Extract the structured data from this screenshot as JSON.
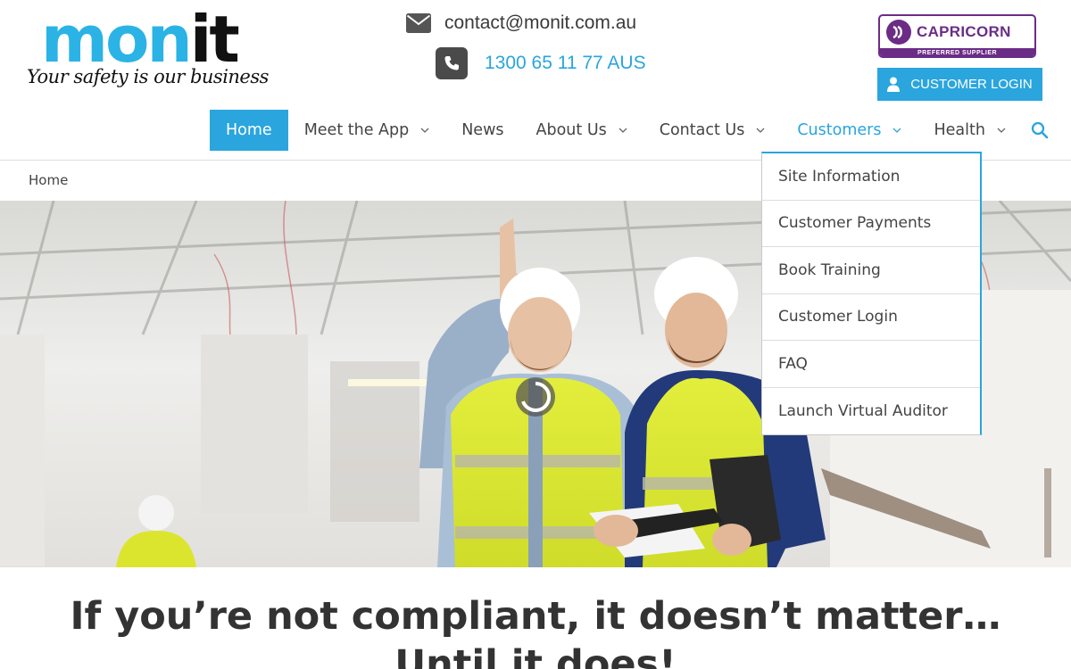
{
  "brand": {
    "logo_part1": "mon",
    "logo_part2": "it",
    "tagline": "Your safety is our business"
  },
  "contact": {
    "email": "contact@monit.com.au",
    "phone": "1300 65 11 77 AUS"
  },
  "partner_badge": {
    "name": "CAPRICORN",
    "subtitle": "PREFERRED SUPPLIER"
  },
  "customer_login_button": "CUSTOMER LOGIN",
  "nav": {
    "items": [
      {
        "label": "Home"
      },
      {
        "label": "Meet the App"
      },
      {
        "label": "News"
      },
      {
        "label": "About Us"
      },
      {
        "label": "Contact Us"
      },
      {
        "label": "Customers"
      },
      {
        "label": "Health"
      }
    ]
  },
  "breadcrumb": "Home",
  "customers_menu": {
    "items": [
      {
        "label": "Site Information"
      },
      {
        "label": "Customer Payments"
      },
      {
        "label": "Book Training"
      },
      {
        "label": "Customer Login"
      },
      {
        "label": "FAQ"
      },
      {
        "label": "Launch Virtual Auditor"
      }
    ]
  },
  "headline": {
    "line1": "If you’re not compliant, it doesn’t matter…",
    "line2": "Until it does!"
  },
  "colors": {
    "accent": "#2aa5de",
    "badge": "#6b2c86",
    "text": "#3a3a3a"
  }
}
